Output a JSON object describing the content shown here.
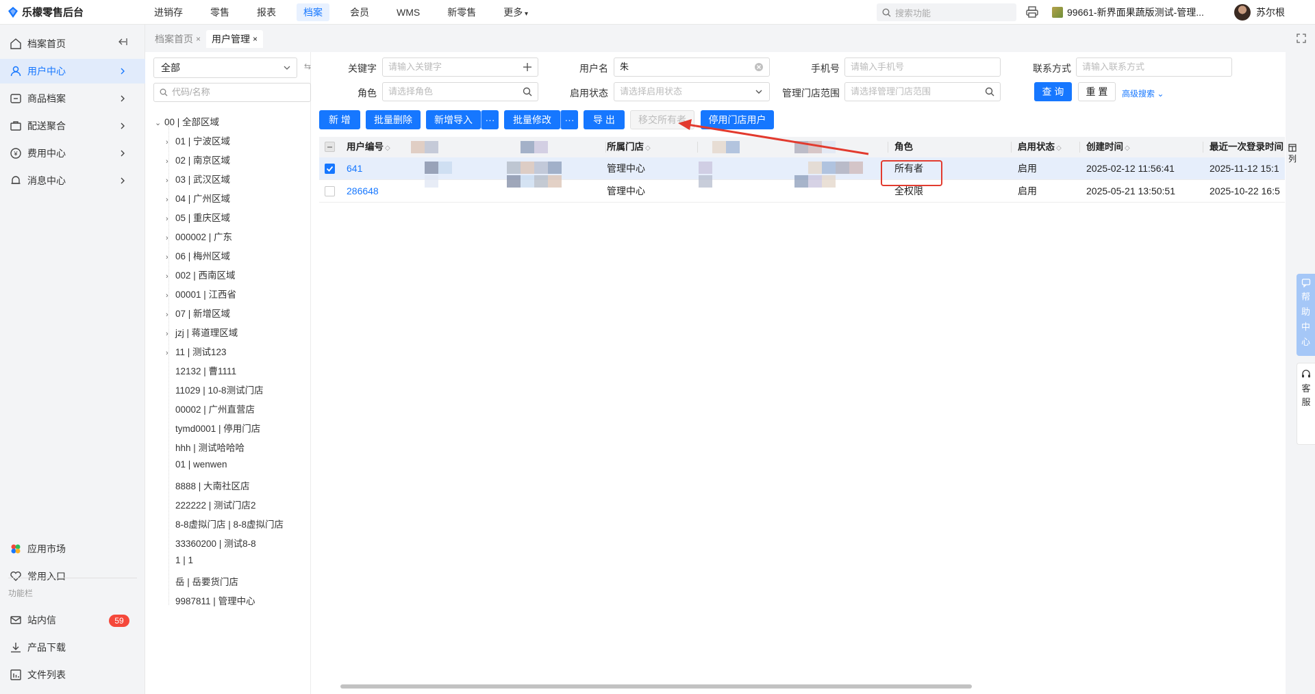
{
  "app": {
    "title": "乐檬零售后台"
  },
  "topnav": [
    "进销存",
    "零售",
    "报表",
    "档案",
    "会员",
    "WMS",
    "新零售",
    "更多"
  ],
  "topnav_active_index": 3,
  "top_search": {
    "placeholder": "搜索功能"
  },
  "store": {
    "label": "99661-新界面果蔬版测试-管理..."
  },
  "user": {
    "name": "苏尔根"
  },
  "sidebar": {
    "items": [
      {
        "label": "档案首页",
        "icon": "home-icon"
      },
      {
        "label": "用户中心",
        "icon": "user-icon",
        "active": true
      },
      {
        "label": "商品档案",
        "icon": "box-icon"
      },
      {
        "label": "配送聚合",
        "icon": "delivery-icon"
      },
      {
        "label": "费用中心",
        "icon": "fee-icon"
      },
      {
        "label": "消息中心",
        "icon": "bell-icon"
      }
    ],
    "bottom": [
      {
        "label": "应用市场",
        "icon": "app-market-icon"
      },
      {
        "label": "常用入口",
        "icon": "heart-icon"
      }
    ],
    "section_title": "功能栏",
    "tools": [
      {
        "label": "站内信",
        "icon": "mail-icon",
        "badge": "59"
      },
      {
        "label": "产品下载",
        "icon": "download-icon"
      },
      {
        "label": "文件列表",
        "icon": "file-list-icon"
      }
    ]
  },
  "tabs": [
    {
      "label": "档案首页",
      "close": "×"
    },
    {
      "label": "用户管理",
      "close": "×",
      "active": true
    }
  ],
  "tree": {
    "select_value": "全部",
    "search_placeholder": "代码/名称",
    "root": "00 | 全部区域",
    "nodes": [
      {
        "label": "01 | 宁波区域",
        "expandable": true
      },
      {
        "label": "02 | 南京区域",
        "expandable": true
      },
      {
        "label": "03 | 武汉区域",
        "expandable": true
      },
      {
        "label": "04 | 广州区域",
        "expandable": true
      },
      {
        "label": "05 | 重庆区域",
        "expandable": true
      },
      {
        "label": "000002 | 广东",
        "expandable": true
      },
      {
        "label": "06 | 梅州区域",
        "expandable": true
      },
      {
        "label": "002 | 西南区域",
        "expandable": true
      },
      {
        "label": "00001 | 江西省",
        "expandable": true
      },
      {
        "label": "07 | 新增区域",
        "expandable": true
      },
      {
        "label": "jzj | 蒋道理区域",
        "expandable": true
      },
      {
        "label": "11 | 测试123",
        "expandable": true
      },
      {
        "label": "12132 | 曹1111",
        "expandable": false
      },
      {
        "label": "11029 | 10-8测试门店",
        "expandable": false
      },
      {
        "label": "00002 | 广州直营店",
        "expandable": false
      },
      {
        "label": "tymd0001 | 停用门店",
        "expandable": false
      },
      {
        "label": "hhh | 测试哈哈哈",
        "expandable": false
      },
      {
        "label": "01 | wenwen",
        "expandable": false
      },
      {
        "label": "8888 | 大南社区店",
        "expandable": false
      },
      {
        "label": "222222 | 测试门店2",
        "expandable": false
      },
      {
        "label": "8-8虚拟门店 | 8-8虚拟门店",
        "expandable": false
      },
      {
        "label": "33360200 | 测试8-8",
        "expandable": false
      },
      {
        "label": "1 | 1",
        "expandable": false
      },
      {
        "label": "岳 | 岳要货门店",
        "expandable": false
      },
      {
        "label": "9987811 | 管理中心",
        "expandable": false
      }
    ]
  },
  "filters": {
    "keyword": {
      "label": "关键字",
      "placeholder": "请输入关键字"
    },
    "username": {
      "label": "用户名",
      "value": "朱"
    },
    "phone": {
      "label": "手机号",
      "placeholder": "请输入手机号"
    },
    "contact": {
      "label": "联系方式",
      "placeholder": "请输入联系方式"
    },
    "role": {
      "label": "角色",
      "placeholder": "请选择角色"
    },
    "status": {
      "label": "启用状态",
      "placeholder": "请选择启用状态"
    },
    "store_range": {
      "label": "管理门店范围",
      "placeholder": "请选择管理门店范围"
    },
    "query": "查 询",
    "reset": "重 置",
    "advanced": "高级搜索"
  },
  "toolbar": {
    "add": "新 增",
    "batch_delete": "批量删除",
    "add_import": "新增导入",
    "more1": "···",
    "batch_edit": "批量修改",
    "more2": "···",
    "export": "导 出",
    "transfer_owner": "移交所有者",
    "disable_users": "停用门店用户"
  },
  "table": {
    "columns": [
      "用户编号",
      "所属门店",
      "角色",
      "启用状态",
      "创建时间",
      "最近一次登录时间"
    ],
    "sort_mark": "◇",
    "rows": [
      {
        "id": "641",
        "store": "管理中心",
        "role": "所有者",
        "status": "启用",
        "created": "2025-02-12 11:56:41",
        "last_login": "2025-11-12 15:1",
        "selected": true
      },
      {
        "id": "286648",
        "store": "管理中心",
        "role": "全权限",
        "status": "启用",
        "created": "2025-05-21 13:50:51",
        "last_login": "2025-10-22 16:5",
        "selected": false
      }
    ]
  },
  "right_float": {
    "column_setting": "列",
    "help": [
      "帮",
      "助",
      "中",
      "心"
    ],
    "service": [
      "客",
      "服"
    ]
  },
  "colors": {
    "primary": "#1677ff",
    "annotation": "#e23a2e",
    "badge": "#f5483b"
  }
}
